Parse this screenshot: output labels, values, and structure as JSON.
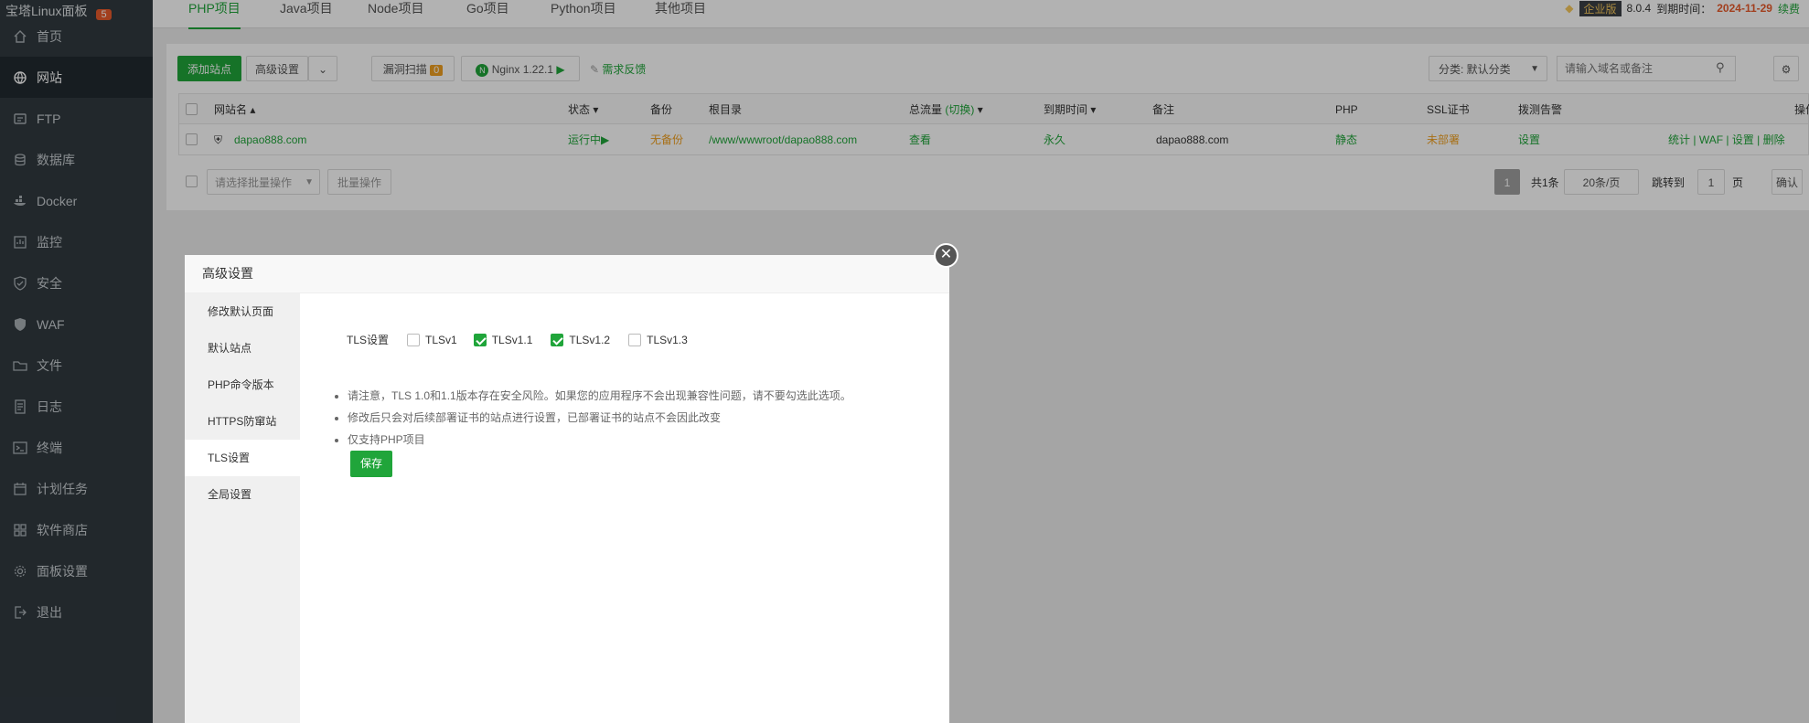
{
  "sidebar": {
    "brand": "宝塔Linux面板",
    "brand_badge": "5",
    "items": [
      {
        "label": "首页",
        "icon": "home-icon"
      },
      {
        "label": "网站",
        "icon": "globe-icon"
      },
      {
        "label": "FTP",
        "icon": "ftp-icon"
      },
      {
        "label": "数据库",
        "icon": "database-icon"
      },
      {
        "label": "Docker",
        "icon": "docker-icon"
      },
      {
        "label": "监控",
        "icon": "monitor-icon"
      },
      {
        "label": "安全",
        "icon": "shield-icon"
      },
      {
        "label": "WAF",
        "icon": "waf-icon"
      },
      {
        "label": "文件",
        "icon": "folder-icon"
      },
      {
        "label": "日志",
        "icon": "log-icon"
      },
      {
        "label": "终端",
        "icon": "terminal-icon"
      },
      {
        "label": "计划任务",
        "icon": "calendar-icon"
      },
      {
        "label": "软件商店",
        "icon": "grid-icon"
      },
      {
        "label": "面板设置",
        "icon": "gear-icon"
      },
      {
        "label": "退出",
        "icon": "logout-icon"
      }
    ]
  },
  "tabs": [
    "PHP项目",
    "Java项目",
    "Node项目",
    "Go项目",
    "Python项目",
    "其他项目"
  ],
  "topbar": {
    "edition": "企业版",
    "version": "8.0.4",
    "expire_label": "到期时间：",
    "expire_date": "2024-11-29",
    "renew": "续费"
  },
  "toolbar": {
    "add_site": "添加站点",
    "advanced": "高级设置",
    "vuln_scan": "漏洞扫描",
    "vuln_count": "0",
    "nginx": "Nginx 1.22.1",
    "feedback": "需求反馈",
    "category": "分类: 默认分类",
    "search_placeholder": "请输入域名或备注"
  },
  "table": {
    "headers": [
      "网站名",
      "状态",
      "备份",
      "根目录",
      "总流量",
      "(切换)",
      "到期时间",
      "备注",
      "PHP",
      "SSL证书",
      "拨测告警",
      "操作"
    ],
    "row": {
      "name": "dapao888.com",
      "status": "运行中",
      "backup": "无备份",
      "root": "/www/wwwroot/dapao888.com",
      "traffic": "查看",
      "expire": "永久",
      "note": "dapao888.com",
      "php": "静态",
      "ssl": "未部署",
      "alert": "设置",
      "ops": [
        "统计",
        "WAF",
        "设置",
        "删除"
      ]
    }
  },
  "footer": {
    "batch_placeholder": "请选择批量操作",
    "batch_button": "批量操作",
    "page": "1",
    "total": "共1条",
    "per_page": "20条/页",
    "jump_label": "跳转到",
    "jump_value": "1",
    "page_unit": "页",
    "confirm": "确认"
  },
  "modal": {
    "title": "高级设置",
    "nav": [
      "修改默认页面",
      "默认站点",
      "PHP命令版本",
      "HTTPS防窜站",
      "TLS设置",
      "全局设置"
    ],
    "tls_label": "TLS设置",
    "options": [
      {
        "label": "TLSv1",
        "checked": false
      },
      {
        "label": "TLSv1.1",
        "checked": true
      },
      {
        "label": "TLSv1.2",
        "checked": true
      },
      {
        "label": "TLSv1.3",
        "checked": false
      }
    ],
    "notes": [
      "请注意，TLS 1.0和1.1版本存在安全风险。如果您的应用程序不会出现兼容性问题，请不要勾选此选项。",
      "修改后只会对后续部署证书的站点进行设置，已部署证书的站点不会因此改变",
      "仅支持PHP项目"
    ],
    "save": "保存"
  }
}
